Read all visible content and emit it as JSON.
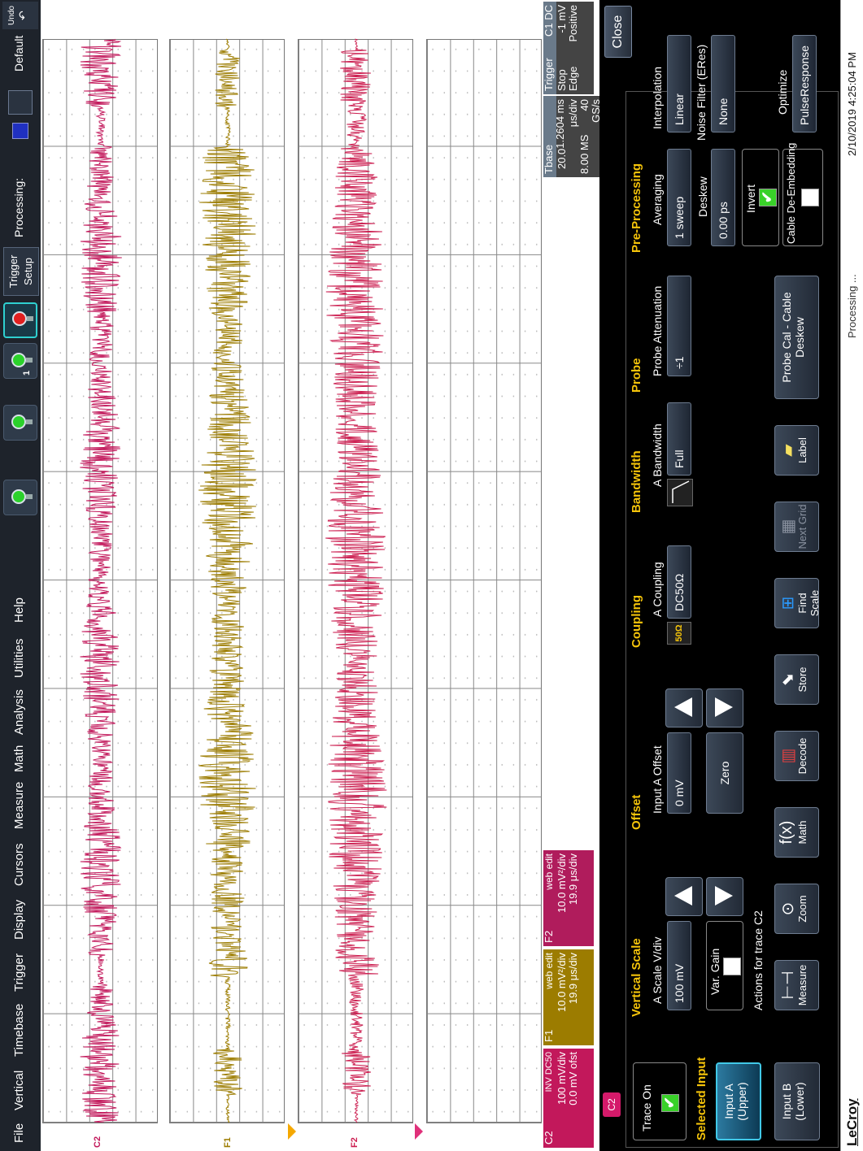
{
  "menu": {
    "items": [
      "File",
      "Vertical",
      "Timebase",
      "Trigger",
      "Display",
      "Cursors",
      "Measure",
      "Math",
      "Analysis",
      "Utilities",
      "Help"
    ]
  },
  "toolbar": {
    "trigger_setup": "Trigger Setup",
    "single_sub": "1",
    "processing_label": "Processing:",
    "default_label": "Default",
    "undo_label": "Undo"
  },
  "traces": {
    "c2_label": "C2",
    "f1_label": "F1",
    "f2_label": "F2"
  },
  "info": {
    "c2": {
      "name": "C2",
      "inv": "INV",
      "coupling": "DC50",
      "scale": "100 mV/div",
      "offset": "0.0 mV ofst"
    },
    "f1": {
      "name": "F1",
      "desc": "web edit",
      "scale": "10.0 mV²/div",
      "time": "19.9 μs/div"
    },
    "f2": {
      "name": "F2",
      "desc": "web edit",
      "scale": "10.0 mV²/div",
      "time": "19.9 μs/div"
    },
    "tbase": {
      "name": "Tbase",
      "delay": "1.2604 ms",
      "timediv": "20.0 μs/div",
      "samples": "8.00 MS",
      "rate": "40 GS/s"
    },
    "trigger": {
      "name": "Trigger",
      "source": "C1",
      "coupling": "DC",
      "mode": "Stop",
      "level": "-1 mV",
      "type": "Edge",
      "slope": "Positive"
    }
  },
  "panel": {
    "tab": "C2",
    "close": "Close",
    "trace_on": "Trace On",
    "selected_input": "Selected Input",
    "input_a": "Input A (Upper)",
    "input_b": "Input B (Lower)",
    "vertical_scale": {
      "title": "Vertical Scale",
      "label": "A Scale V/div",
      "value": "100 mV",
      "var_gain": "Var. Gain"
    },
    "offset": {
      "title": "Offset",
      "label": "Input A Offset",
      "value": "0 mV",
      "zero": "Zero"
    },
    "coupling": {
      "title": "Coupling",
      "label": "A Coupling",
      "value": "DC50Ω",
      "icon": "50Ω"
    },
    "bandwidth": {
      "title": "Bandwidth",
      "label": "A Bandwidth",
      "value": "Full"
    },
    "probe": {
      "title": "Probe",
      "label": "Probe Attenuation",
      "value": "÷1",
      "cal": "Probe Cal - Cable Deskew"
    },
    "preproc": {
      "title": "Pre-Processing",
      "averaging": "Averaging",
      "avg_value": "1 sweep",
      "deskew": "Deskew",
      "deskew_value": "0.00 ps",
      "invert": "Invert",
      "cable": "Cable De-Embedding"
    },
    "interp": {
      "label": "Interpolation",
      "value": "Linear",
      "noise": "Noise Filter (ERes)",
      "noise_value": "None",
      "optimize": "Optimize",
      "opt_value": "PulseResponse"
    },
    "actions_title": "Actions for trace C2",
    "actions": [
      "Measure",
      "Zoom",
      "Math",
      "Decode",
      "Store",
      "Find Scale",
      "Next Grid",
      "Label"
    ]
  },
  "status": {
    "brand": "LeCroy",
    "processing": "Processing ...",
    "datetime": "2/10/2019 4:25:04 PM"
  },
  "colors": {
    "c2": "#c2185b",
    "f1": "#9c7c00",
    "f2": "#cc1e50",
    "accent": "#f5c40a"
  }
}
